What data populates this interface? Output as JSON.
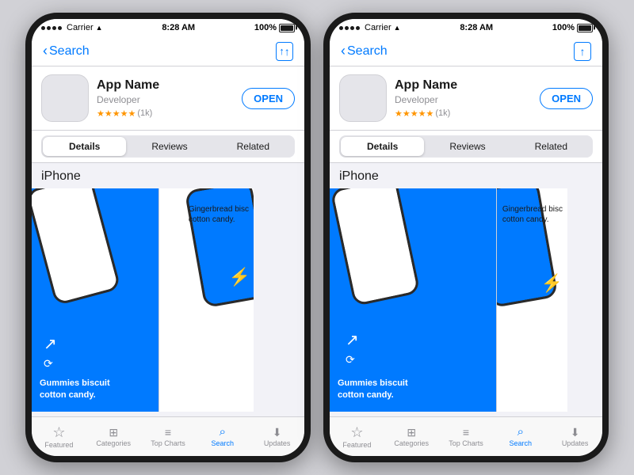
{
  "phones": [
    {
      "id": "left",
      "statusBar": {
        "carrier": "Carrier",
        "time": "8:28 AM",
        "battery": "100%"
      },
      "navBar": {
        "backLabel": "Search",
        "shareLabel": "Share"
      },
      "appHeader": {
        "name": "App Name",
        "developer": "Developer",
        "rating": "★★★★★",
        "ratingCount": "(1k)",
        "openBtn": "OPEN"
      },
      "tabs": [
        {
          "label": "Details",
          "active": true
        },
        {
          "label": "Reviews",
          "active": false
        },
        {
          "label": "Related",
          "active": false
        }
      ],
      "screenshotsLabel": "iPhone",
      "bottomTabs": [
        {
          "icon": "☆",
          "label": "Featured",
          "active": false
        },
        {
          "icon": "⊞",
          "label": "Categories",
          "active": false
        },
        {
          "icon": "≡",
          "label": "Top Charts",
          "active": false
        },
        {
          "icon": "🔍",
          "label": "Search",
          "active": true
        },
        {
          "icon": "↓",
          "label": "Updates",
          "active": false
        }
      ]
    },
    {
      "id": "right",
      "statusBar": {
        "carrier": "Carrier",
        "time": "8:28 AM",
        "battery": "100%"
      },
      "navBar": {
        "backLabel": "Search",
        "shareLabel": "Share"
      },
      "appHeader": {
        "name": "App Name",
        "developer": "Developer",
        "rating": "★★★★★",
        "ratingCount": "(1k)",
        "openBtn": "OPEN"
      },
      "tabs": [
        {
          "label": "Details",
          "active": true
        },
        {
          "label": "Reviews",
          "active": false
        },
        {
          "label": "Related",
          "active": false
        }
      ],
      "screenshotsLabel": "iPhone",
      "bottomTabs": [
        {
          "icon": "☆",
          "label": "Featured",
          "active": false
        },
        {
          "icon": "⊞",
          "label": "Categories",
          "active": false
        },
        {
          "icon": "≡",
          "label": "Top Charts",
          "active": false
        },
        {
          "icon": "🔍",
          "label": "Search",
          "active": true
        },
        {
          "icon": "↓",
          "label": "Updates",
          "active": false
        }
      ]
    }
  ],
  "screenshot1": {
    "gummies": "Gummies biscuit\ncotton candy.",
    "gingerbread": "Gingerbread bisc\ncotton candy."
  },
  "bottomTabLabels": {
    "featured": "Featured",
    "categories": "Categories",
    "topCharts": "Top Charts",
    "search": "Search",
    "updates": "Updates"
  }
}
